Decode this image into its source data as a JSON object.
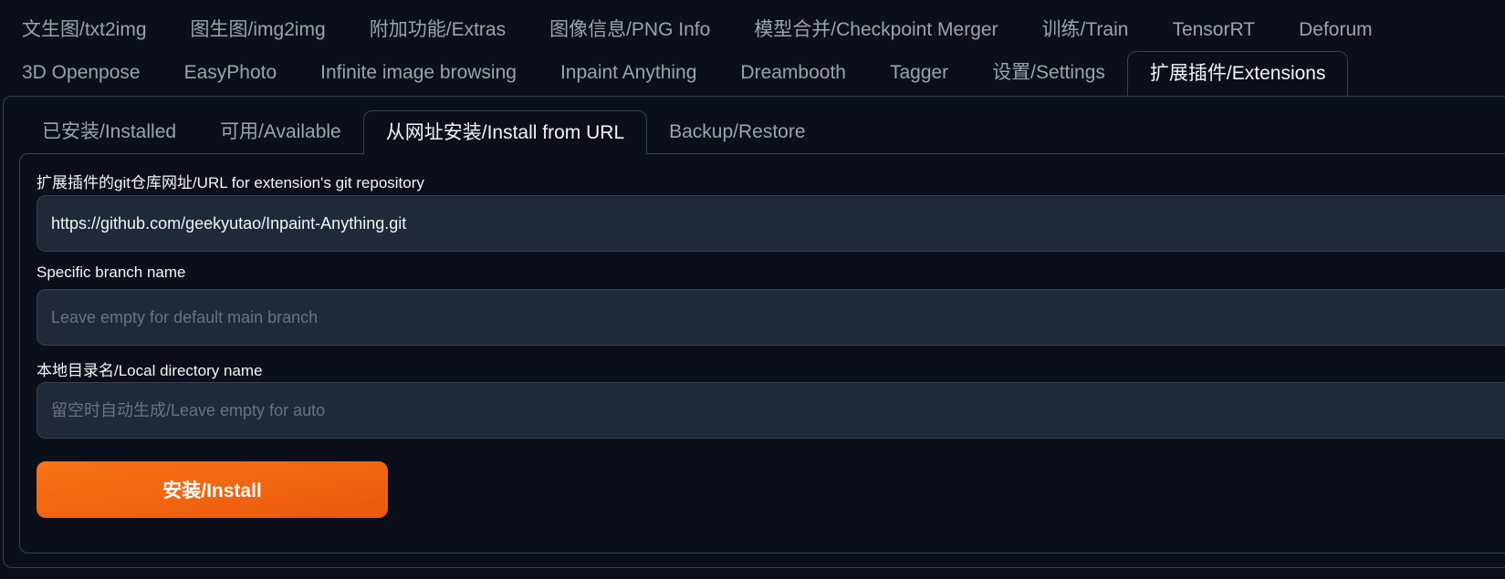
{
  "top_tabs": {
    "row1": [
      {
        "label": "文生图/txt2img"
      },
      {
        "label": "图生图/img2img"
      },
      {
        "label": "附加功能/Extras"
      },
      {
        "label": "图像信息/PNG Info"
      },
      {
        "label": "模型合并/Checkpoint Merger"
      },
      {
        "label": "训练/Train"
      },
      {
        "label": "TensorRT"
      },
      {
        "label": "Deforum"
      }
    ],
    "row2": [
      {
        "label": "3D Openpose"
      },
      {
        "label": "EasyPhoto"
      },
      {
        "label": "Infinite image browsing"
      },
      {
        "label": "Inpaint Anything"
      },
      {
        "label": "Dreambooth"
      },
      {
        "label": "Tagger"
      },
      {
        "label": "设置/Settings"
      },
      {
        "label": "扩展插件/Extensions",
        "active": true
      }
    ]
  },
  "sub_tabs": [
    {
      "label": "已安装/Installed"
    },
    {
      "label": "可用/Available"
    },
    {
      "label": "从网址安装/Install from URL",
      "active": true
    },
    {
      "label": "Backup/Restore"
    }
  ],
  "form": {
    "url_label": "扩展插件的git仓库网址/URL for extension's git repository",
    "url_value": "https://github.com/geekyutao/Inpaint-Anything.git",
    "branch_label": "Specific branch name",
    "branch_placeholder": "Leave empty for default main branch",
    "branch_value": "",
    "dir_label": "本地目录名/Local directory name",
    "dir_placeholder": "留空时自动生成/Leave empty for auto",
    "dir_value": "",
    "install_label": "安装/Install"
  },
  "colors": {
    "background": "#0b0f19",
    "input_bg": "#1f2937",
    "border": "#374151",
    "accent_orange": "#f97316"
  }
}
